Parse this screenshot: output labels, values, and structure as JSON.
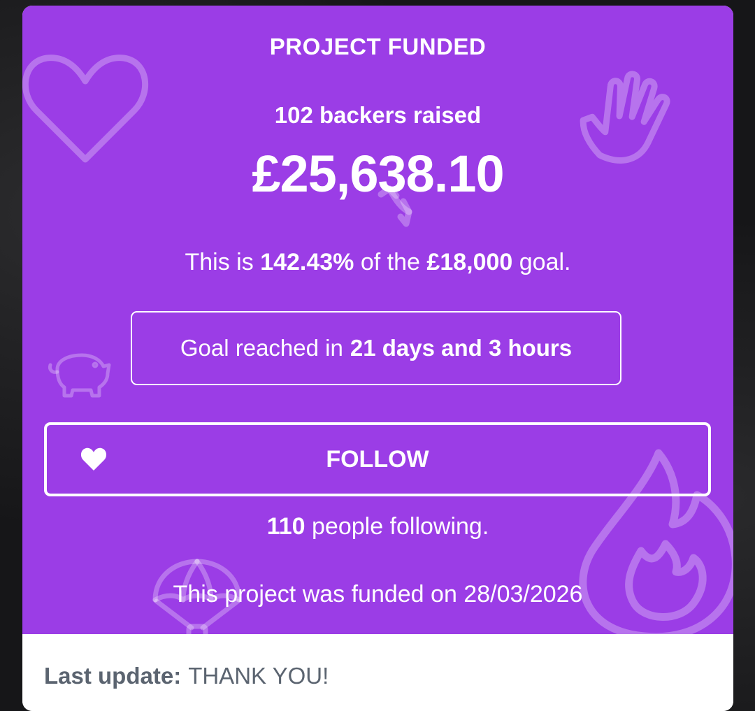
{
  "card": {
    "heading": "PROJECT FUNDED",
    "backers_text": "102 backers raised",
    "amount": "£25,638.10",
    "goal_line": {
      "prefix": "This is",
      "percent": "142.43%",
      "middle": "of the",
      "goal": "£18,000",
      "suffix": "goal."
    },
    "reached": {
      "prefix": "Goal reached in",
      "duration": "21 days and 3 hours"
    },
    "follow_button": {
      "label": "FOLLOW",
      "icon": "heart-icon"
    },
    "following": {
      "count": "110",
      "suffix": "people following."
    },
    "funded_on": "This project was funded on 28/03/2026"
  },
  "footer": {
    "last_update_label": "Last update:",
    "last_update_value": "THANK YOU!"
  },
  "colors": {
    "panel": "#9b3de6",
    "text": "#ffffff",
    "footer_text": "#5b6470"
  },
  "decorations": [
    "heart-icon",
    "hand-icon",
    "rocket-icon",
    "piggy-bank-icon",
    "parachute-icon",
    "flame-icon"
  ]
}
